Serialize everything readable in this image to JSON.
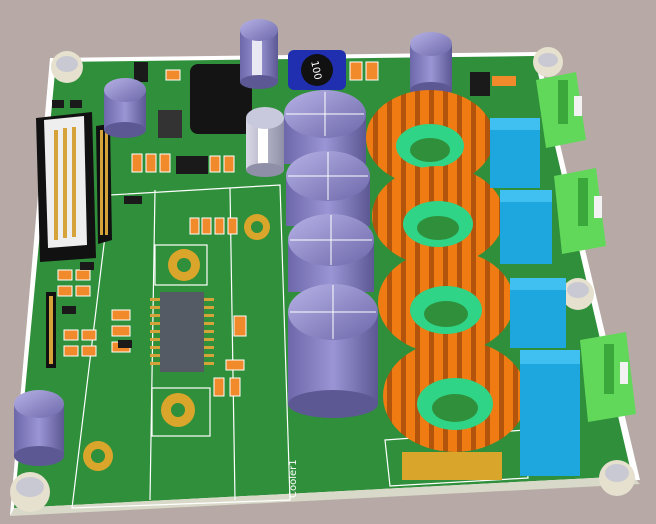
{
  "scene": {
    "background_color": "#b7aaa6",
    "board_color": "#2f8f3a",
    "board_edge_color": "#ffffff",
    "copper_color": "#d9a52a",
    "capacitor_color": "#8b86c7",
    "toroid_color": "#f07b13",
    "toroid_core_color": "#2fd486",
    "film_cap_color": "#1ea6df",
    "terminal_color": "#61d85a",
    "connector_color": "#111111",
    "pin_color": "#d6a23a"
  },
  "labels": {
    "inductor_marking": "100",
    "silkscreen_cooler": "Cooler1"
  },
  "components": {
    "electrolytic_capacitors_large": 4,
    "electrolytic_capacitors_small": 5,
    "toroidal_inductors": 4,
    "film_capacitors": 4,
    "screw_terminals": 3,
    "mounting_holes": 5,
    "heat_sink_mount_pads": 3
  }
}
